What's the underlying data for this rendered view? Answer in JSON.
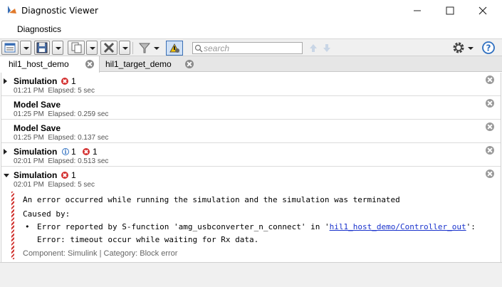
{
  "window": {
    "title": "Diagnostic Viewer"
  },
  "ribbon": {
    "tab_label": "Diagnostics"
  },
  "toolbar": {
    "search_placeholder": "search"
  },
  "tabs": [
    {
      "label": "hil1_host_demo",
      "active": true
    },
    {
      "label": "hil1_target_demo",
      "active": false
    }
  ],
  "rows": [
    {
      "title": "Simulation",
      "errors": "1",
      "time": "01:21 PM",
      "elapsed": "Elapsed: 5 sec",
      "expandable": true,
      "expanded": false
    },
    {
      "title": "Model Save",
      "time": "01:25 PM",
      "elapsed": "Elapsed: 0.259 sec",
      "expandable": false
    },
    {
      "title": "Model Save",
      "time": "01:25 PM",
      "elapsed": "Elapsed: 0.137 sec",
      "expandable": false
    },
    {
      "title": "Simulation",
      "infos": "1",
      "errors": "1",
      "time": "02:01 PM",
      "elapsed": "Elapsed: 0.513 sec",
      "expandable": true,
      "expanded": false
    },
    {
      "title": "Simulation",
      "errors": "1",
      "time": "02:01 PM",
      "elapsed": "Elapsed: 5 sec",
      "expandable": true,
      "expanded": true
    }
  ],
  "detail": {
    "message": "An error occurred while running the simulation and the simulation was terminated",
    "caused_by": "Caused by:",
    "bullet": "•",
    "cause_prefix": "Error reported by S-function 'amg_usbconverter_n_connect' in '",
    "cause_link": "hil1_host_demo/Controller_out",
    "cause_suffix": "':",
    "cause_detail": "Error: timeout occur while waiting for Rx data.",
    "component_line": "Component:  Simulink | Category:  Block error"
  },
  "colors": {
    "error": "#d32f2f",
    "info": "#2e6fc0",
    "link": "#1a33cc"
  }
}
